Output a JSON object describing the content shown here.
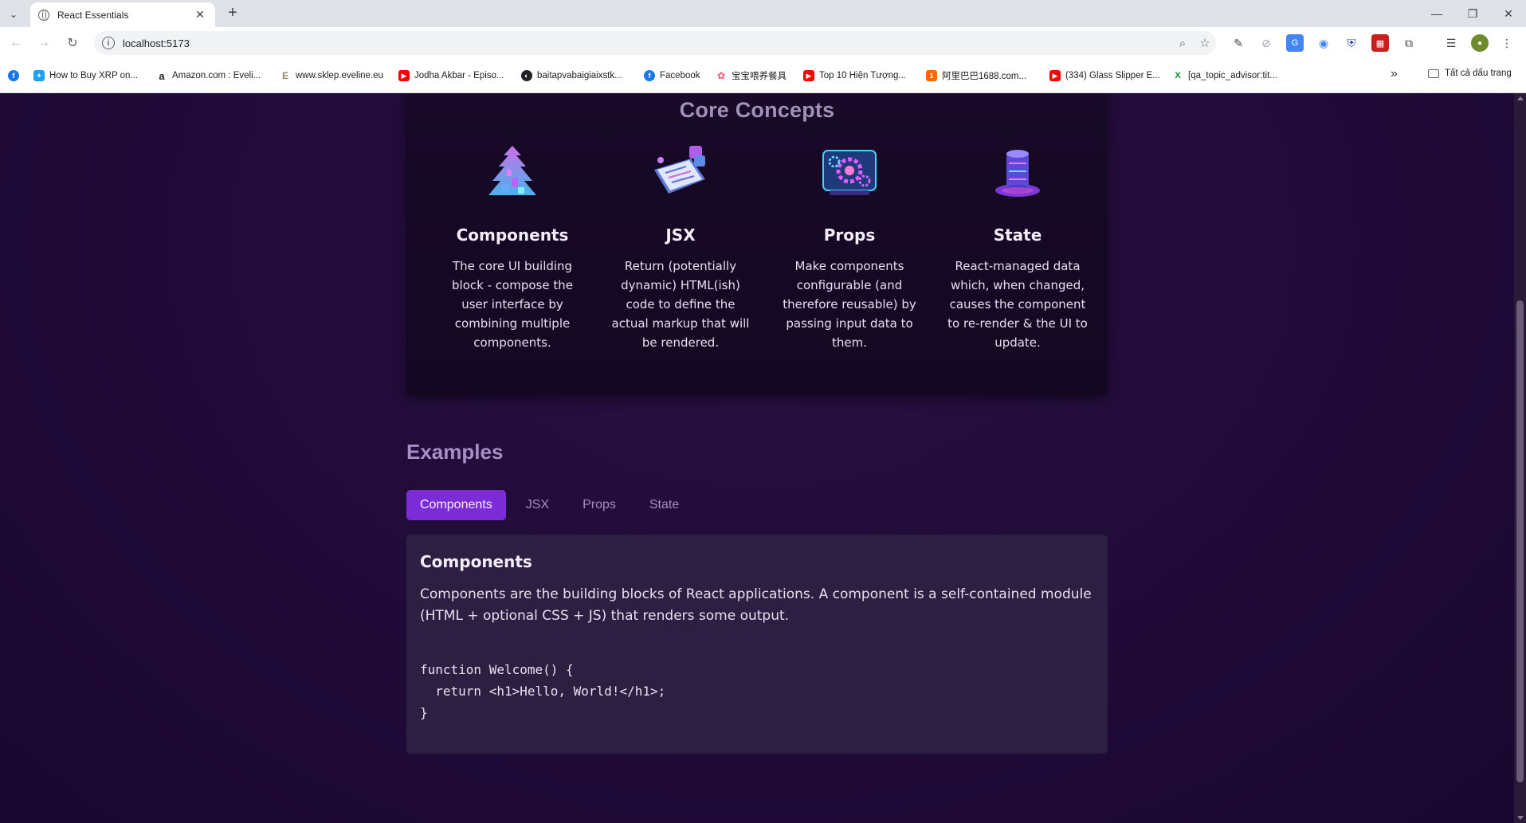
{
  "browser": {
    "tab_title": "React Essentials",
    "url": "localhost:5173",
    "bookmarks": [
      {
        "label": "How to Buy XRP on...",
        "color": "#1da1f2"
      },
      {
        "label": "Amazon.com : Eveli...",
        "color": "#222222"
      },
      {
        "label": "www.sklep.eveline.eu",
        "color": "#c9b99a"
      },
      {
        "label": "Jodha Akbar - Episo...",
        "color": "#ff0000"
      },
      {
        "label": "baitapvabaigiaixstk...",
        "color": "#202124"
      },
      {
        "label": "Facebook",
        "color": "#1877f2"
      },
      {
        "label": "宝宝喂养餐具",
        "color": "#ff4f7b"
      },
      {
        "label": "Top 10 Hiện Tượng...",
        "color": "#ff0000"
      },
      {
        "label": "阿里巴巴1688.com...",
        "color": "#ff6a00"
      },
      {
        "label": "(334) Glass Slipper E...",
        "color": "#ff0000"
      },
      {
        "label": "[qa_topic_advisor:tit...",
        "color": "#188038"
      }
    ],
    "bookmarks_folder": "Tất cả dấu trang"
  },
  "core_concepts": {
    "title": "Core Concepts",
    "items": [
      {
        "title": "Components",
        "description": "The core UI building block - compose the user interface by combining multiple components.",
        "icon": "components-icon"
      },
      {
        "title": "JSX",
        "description": "Return (potentially dynamic) HTML(ish) code to define the actual markup that will be rendered.",
        "icon": "jsx-icon"
      },
      {
        "title": "Props",
        "description": "Make components configurable (and therefore reusable) by passing input data to them.",
        "icon": "props-icon"
      },
      {
        "title": "State",
        "description": "React-managed data which, when changed, causes the component to re-render & the UI to update.",
        "icon": "state-icon"
      }
    ]
  },
  "examples": {
    "title": "Examples",
    "tabs": [
      "Components",
      "JSX",
      "Props",
      "State"
    ],
    "active_tab": "Components",
    "content": {
      "title": "Components",
      "description": "Components are the building blocks of React applications. A component is a self-contained module (HTML + optional CSS + JS) that renders some output.",
      "code": "function Welcome() {\n  return <h1>Hello, World!</h1>;\n}"
    }
  },
  "colors": {
    "accent": "#7b2cd6",
    "page_bg": "#220c3a",
    "panel_bg": "#180a28",
    "content_bg": "#2c1f42"
  }
}
